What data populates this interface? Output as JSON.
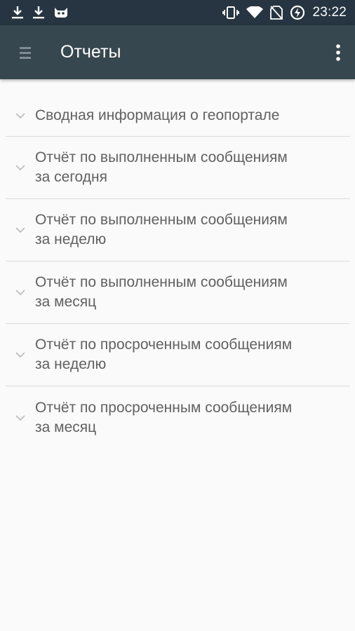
{
  "status_bar": {
    "time": "23:22",
    "left_icons": [
      "download-icon",
      "download-icon",
      "cyanogen-icon"
    ],
    "right_icons": [
      "vibrate-icon",
      "wifi-icon",
      "no-sim-icon",
      "battery-charging-icon"
    ]
  },
  "app_bar": {
    "title": "Отчеты",
    "menu_icon": "hamburger-icon",
    "overflow_icon": "more-vert-icon"
  },
  "reports": [
    {
      "line1": "Сводная информация о геопортале",
      "line2": ""
    },
    {
      "line1": "Отчёт по выполненным сообщениям",
      "line2": "за сегодня"
    },
    {
      "line1": "Отчёт по выполненным сообщениям",
      "line2": "за неделю"
    },
    {
      "line1": "Отчёт по выполненным сообщениям",
      "line2": "за месяц"
    },
    {
      "line1": "Отчёт по просроченным сообщениям",
      "line2": "за неделю"
    },
    {
      "line1": "Отчёт по просроченным сообщениям",
      "line2": "за месяц"
    }
  ],
  "colors": {
    "status_bar": "#263541",
    "app_bar": "#37474f",
    "background": "#fafafa",
    "text": "#616161",
    "divider": "#dcdcdc"
  }
}
